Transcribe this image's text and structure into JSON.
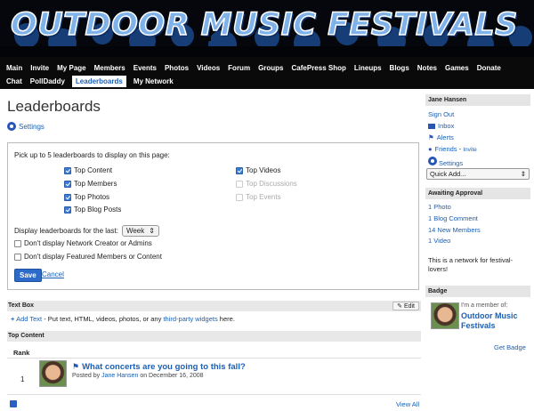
{
  "header": {
    "banner_title": "OUTDOOR MUSIC FESTIVALS"
  },
  "nav": {
    "row1": [
      "Main",
      "Invite",
      "My Page",
      "Members",
      "Events",
      "Photos",
      "Videos",
      "Forum",
      "Groups",
      "CafePress Shop",
      "Lineups",
      "Blogs",
      "Notes",
      "Games",
      "Donate"
    ],
    "row2": [
      "Chat",
      "PollDaddy",
      "Leaderboards",
      "My Network"
    ],
    "active": "Leaderboards"
  },
  "page": {
    "title": "Leaderboards",
    "settings_link": "Settings",
    "panel": {
      "intro": "Pick up to 5 leaderboards to display on this page:",
      "checkboxes_left": [
        {
          "label": "Top Content",
          "checked": true
        },
        {
          "label": "Top Members",
          "checked": true
        },
        {
          "label": "Top Photos",
          "checked": true
        },
        {
          "label": "Top Blog Posts",
          "checked": true
        }
      ],
      "checkboxes_right": [
        {
          "label": "Top Videos",
          "checked": true,
          "disabled": false
        },
        {
          "label": "Top Discussions",
          "checked": false,
          "disabled": true
        },
        {
          "label": "Top Events",
          "checked": false,
          "disabled": true
        }
      ],
      "period_label": "Display leaderboards for the last:",
      "period_value": "Week",
      "opt_creator": "Don't display Network Creator or Admins",
      "opt_featured": "Don't display Featured Members or Content",
      "save": "Save",
      "cancel": "Cancel"
    },
    "textbox": {
      "head": "Text Box",
      "edit": "Edit",
      "add_text": "Add Text",
      "desc": " - Put text, HTML, videos, photos, or any ",
      "widgets_link": "third-party widgets",
      "desc_end": " here."
    },
    "top_content": {
      "head": "Top Content",
      "rank_head": "Rank",
      "rank": "1",
      "topic_title": "What concerts are you going to this fall?",
      "posted_by": "Posted by",
      "author": "Jane Hansen",
      "date": "on December 16, 2008",
      "view_all": "View All"
    }
  },
  "sidebar": {
    "user_name": "Jane Hansen",
    "sign_out": "Sign Out",
    "inbox": "Inbox",
    "alerts": "Alerts",
    "friends": "Friends",
    "invite": "Invite",
    "settings": "Settings",
    "quick_add": "Quick Add...",
    "approval_head": "Awaiting Approval",
    "approval_items": [
      "1 Photo",
      "1 Blog Comment",
      "14 New Members",
      "1 Video"
    ],
    "network_text": "This is a network for festival-lovers!",
    "badge_head": "Badge",
    "badge_caption": "I'm a member of:",
    "badge_name": "Outdoor Music Festivals",
    "get_badge": "Get Badge"
  },
  "colors": {
    "link": "#1a5fb4",
    "nav_bg": "#0a0a0a",
    "banner_text": "#7fb2e8",
    "save_button": "#2c6bc9"
  }
}
